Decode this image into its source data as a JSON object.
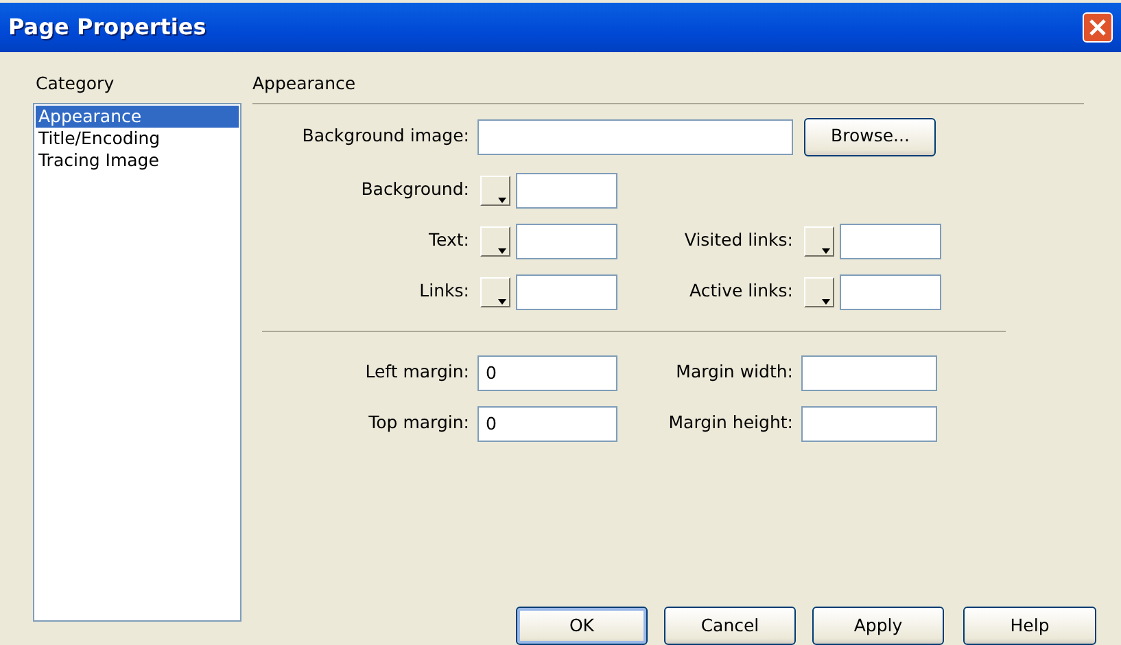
{
  "window": {
    "title": "Page Properties"
  },
  "category": {
    "label": "Category",
    "items": [
      {
        "label": "Appearance",
        "selected": true
      },
      {
        "label": "Title/Encoding",
        "selected": false
      },
      {
        "label": "Tracing Image",
        "selected": false
      }
    ]
  },
  "section": {
    "title": "Appearance"
  },
  "image_field": {
    "label": "Background image:",
    "button": "Browse..."
  },
  "color_rows": [
    [
      {
        "label": "Background:"
      }
    ],
    [
      {
        "label": "Text:"
      },
      {
        "label": "Visited links:"
      }
    ],
    [
      {
        "label": "Links:"
      },
      {
        "label": "Active links:"
      }
    ]
  ],
  "margin_rows": [
    [
      {
        "label": "Left margin:",
        "value": "0"
      },
      {
        "label": "Margin width:"
      }
    ],
    [
      {
        "label": "Top margin:",
        "value": "0"
      },
      {
        "label": "Margin height:"
      }
    ]
  ],
  "buttons": [
    {
      "label": "OK",
      "default": true
    },
    {
      "label": "Cancel",
      "default": false
    },
    {
      "label": "Apply",
      "default": false
    },
    {
      "label": "Help",
      "default": false
    }
  ]
}
